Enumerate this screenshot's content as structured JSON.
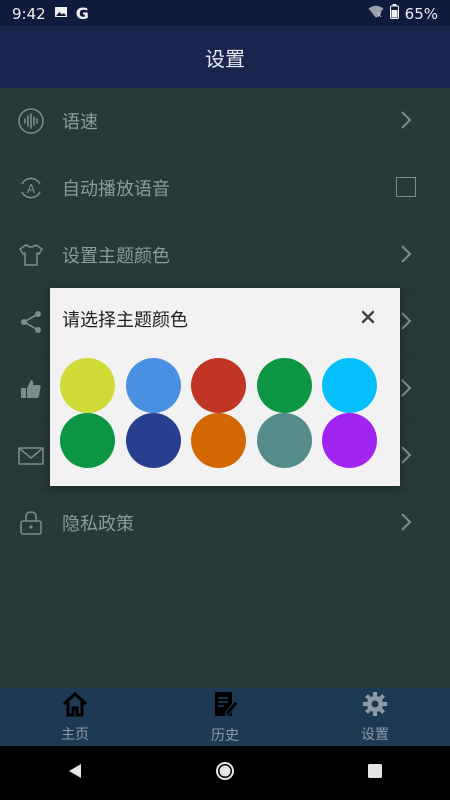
{
  "status_bar": {
    "time": "9:42",
    "battery": "65%"
  },
  "app_bar": {
    "title": "设置"
  },
  "settings": {
    "items": [
      {
        "label": "语速",
        "icon": "voice-wave-icon",
        "trailing": "chevron"
      },
      {
        "label": "自动播放语音",
        "icon": "auto-play-voice-icon",
        "trailing": "checkbox",
        "checked": false
      },
      {
        "label": "设置主题颜色",
        "icon": "tshirt-icon",
        "trailing": "chevron"
      },
      {
        "label": "",
        "icon": "share-icon",
        "trailing": "chevron"
      },
      {
        "label": "",
        "icon": "thumbs-up-icon",
        "trailing": "chevron"
      },
      {
        "label": "",
        "icon": "mail-icon",
        "trailing": "chevron"
      },
      {
        "label": "隐私政策",
        "icon": "lock-icon",
        "trailing": "chevron"
      }
    ]
  },
  "dialog": {
    "title": "请选择主题颜色",
    "colors": [
      "#cfdb37",
      "#4a90e0",
      "#c03523",
      "#0c9543",
      "#04bffc",
      "#0c9543",
      "#273f8e",
      "#d36803",
      "#568b8c",
      "#a124f0"
    ]
  },
  "bottom_nav": {
    "items": [
      {
        "label": "主页",
        "icon": "home-icon"
      },
      {
        "label": "历史",
        "icon": "history-icon"
      },
      {
        "label": "设置",
        "icon": "settings-gear-icon"
      }
    ]
  },
  "theme": {
    "status_bar_bg": "#0f1a3c",
    "app_bar_bg": "#1a244f",
    "page_bg": "#273a39",
    "bottom_nav_bg": "#1d3954",
    "dialog_bg": "#f2f2f2"
  }
}
